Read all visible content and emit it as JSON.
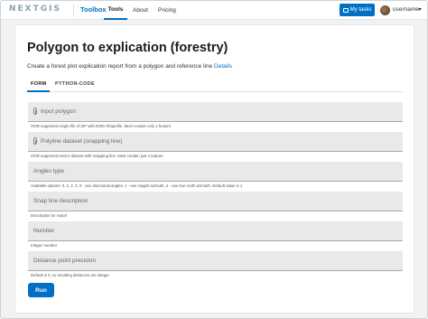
{
  "header": {
    "logo": "NEXTGIS",
    "product": "Toolbox",
    "nav": [
      "Tools",
      "About",
      "Pricing"
    ],
    "my_tasks": "My tasks",
    "username": "username"
  },
  "page": {
    "title": "Polygon to explication (forestry)",
    "description": "Create a forest plot explication report from a polygon and reference line",
    "details_link": "Details"
  },
  "tabs": [
    "FORM",
    "PYTHON-CODE"
  ],
  "fields": [
    {
      "label": "Input polygon",
      "help": "OGR-supported single file of ZIP with ESRI Shapefile. Must contain only 1 feature"
    },
    {
      "label": "Polyline dataset (snapping line)",
      "help": "OGR-supported vector dataset with snapping line. Must contain just 1 feature"
    },
    {
      "label": "Angles type",
      "help": "Available options: 0, 1, 2, 3. 0 - use directional angles, 1 - use magnit azimuth, 2 - use true north azimuth. Default value is 1"
    },
    {
      "label": "Snap line description",
      "help": "Description for report"
    },
    {
      "label": "Number",
      "help": "Integer number"
    },
    {
      "label": "Distance point precision",
      "help": "Default is 0, so resulting distances are integer"
    }
  ],
  "run_label": "Run",
  "colors": {
    "accent": "#0070c5",
    "field_bg": "#e9e9e9"
  }
}
